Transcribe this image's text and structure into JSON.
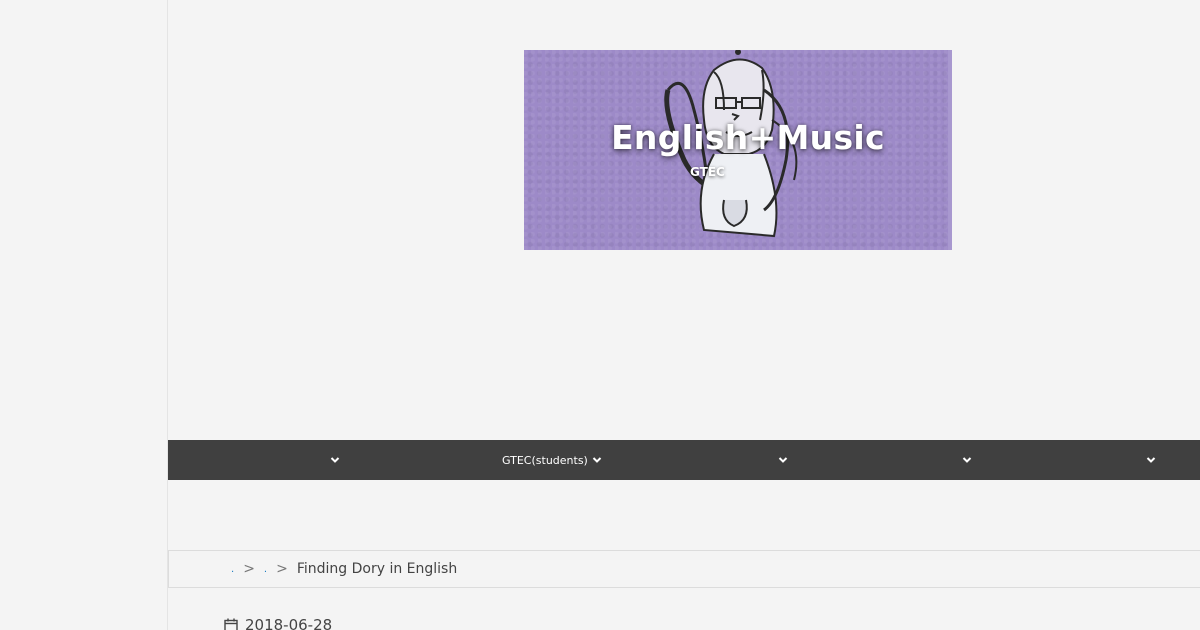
{
  "header": {
    "site_title": "English+Music",
    "site_subtitle": "GTEC",
    "banner_color": "#9d8ac8"
  },
  "nav": {
    "items": [
      {
        "label": "",
        "icon": "chevron-down-icon"
      },
      {
        "label": "GTEC(students)",
        "icon": "chevron-down-icon"
      },
      {
        "label": "",
        "icon": "chevron-down-icon"
      },
      {
        "label": "",
        "icon": "chevron-down-icon"
      },
      {
        "label": "",
        "icon": "chevron-down-icon"
      }
    ],
    "background": "#404040"
  },
  "breadcrumb": {
    "home_label": ".",
    "category_label": ".",
    "separator": ">",
    "current": "Finding Dory in English"
  },
  "post": {
    "date": "2018-06-28",
    "date_icon": "calendar-icon"
  }
}
